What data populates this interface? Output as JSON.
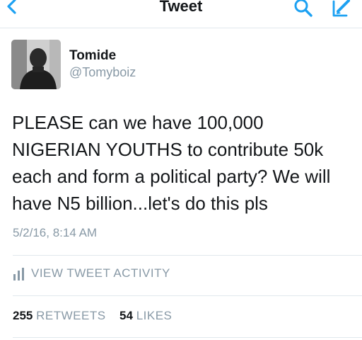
{
  "nav": {
    "title": "Tweet",
    "back_icon": "chevron-left-icon",
    "search_icon": "search-icon",
    "compose_icon": "compose-icon",
    "accent_color": "#1da1f2"
  },
  "author": {
    "name": "Tomide",
    "handle": "@Tomyboiz",
    "avatar_icon": "avatar"
  },
  "tweet": {
    "text": "PLEASE can we have 100,000 NIGERIAN YOUTHS to contribute 50k each and form a political party? We will have N5 billion...let's do this pls",
    "timestamp": "5/2/16, 8:14 AM"
  },
  "activity": {
    "label": "VIEW TWEET ACTIVITY",
    "icon": "bar-chart-icon"
  },
  "stats": {
    "retweets_count": "255",
    "retweets_label": "RETWEETS",
    "likes_count": "54",
    "likes_label": "LIKES"
  }
}
